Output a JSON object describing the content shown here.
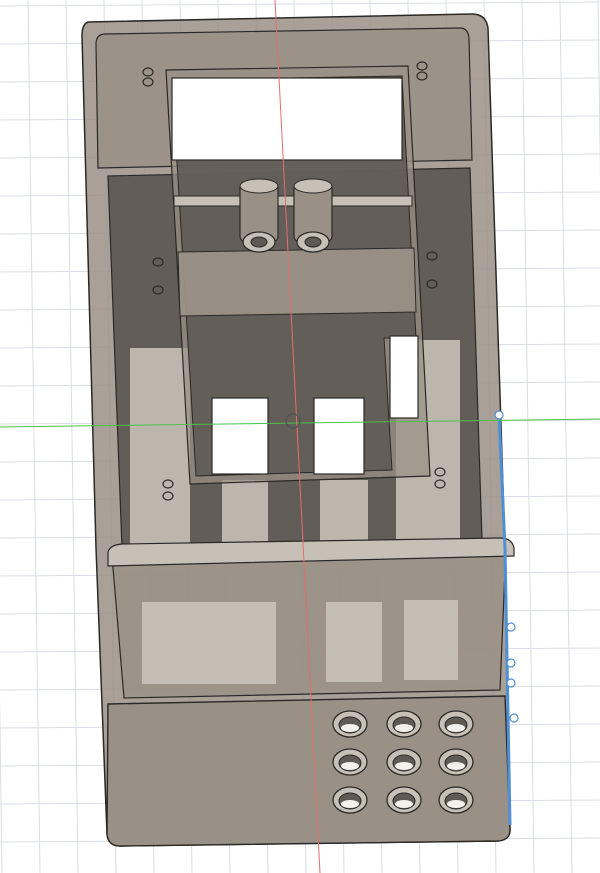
{
  "viewport": {
    "background": "#ffffff",
    "grid_color": "#d9dde3",
    "grid_major_color": "#c4c9d1",
    "axis_x_color": "#4cc24c",
    "axis_y_color": "#e07070"
  },
  "model": {
    "body_color": "#9a9186",
    "body_dark": "#5f5a54",
    "body_light": "#c7c0b6",
    "edge_color": "#2b2926",
    "window_color": "#ffffff",
    "highlight_edge": "#4f8fd6",
    "selected_point_color": "#ffffff"
  }
}
